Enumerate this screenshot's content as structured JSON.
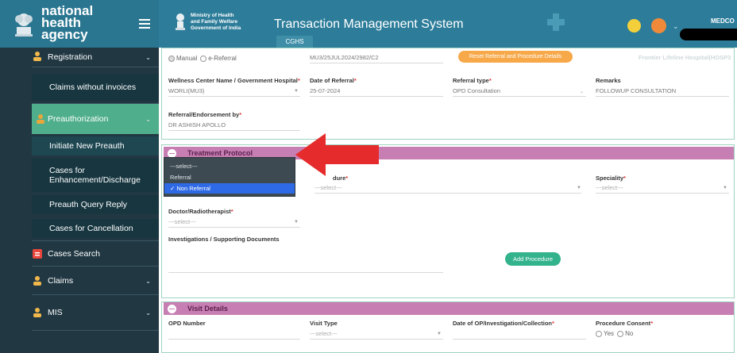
{
  "header": {
    "brand_line1": "national",
    "brand_line2": "health",
    "brand_line3": "agency",
    "ministry_line1": "Ministry of Health",
    "ministry_line2": "and Family Welfare",
    "ministry_line3": "Government of India",
    "title": "Transaction Management System",
    "tab_label": "CGHS",
    "user_label": "MEDCO"
  },
  "sidebar": {
    "registration": "Registration",
    "claims_without_invoices": "Claims without invoices",
    "preauthorization": "Preauthorization",
    "initiate_new_preauth": "Initiate New Preauth",
    "cases_enhancement_line1": "Cases for",
    "cases_enhancement_line2": "Enhancement/Discharge",
    "preauth_query_reply": "Preauth Query Reply",
    "cases_cancellation": "Cases for Cancellation",
    "cases_search": "Cases Search",
    "claims": "Claims",
    "mis": "MIS"
  },
  "referral": {
    "type_manual": "Manual",
    "type_ereferral": "e-Referral",
    "referral_number": "MU3/25JUL2024/2982/C2",
    "reset_button": "Reset Referral and Procedure Details",
    "hospital_faint": "Frontier Lifeline Hospital(HOSP3",
    "wellness_label": "Wellness Center Name / Government Hospital",
    "wellness_value": "WORLI(MU3)",
    "date_label": "Date of Referral",
    "date_value": "25-07-2024",
    "type_label": "Referral type",
    "type_value": "OPD Consultation",
    "remarks_label": "Remarks",
    "remarks_value": "FOLLOWUP CONSULTATION",
    "endorsement_label": "Referral/Endorsement by",
    "endorsement_value": "DR ASHISH APOLLO"
  },
  "treatment": {
    "section_title": "Treatment Protocol",
    "dropdown_options": [
      "---select---",
      "Referral",
      "Non Referral"
    ],
    "dropdown_selected_mark": "✓",
    "procedure_label": "dure",
    "procedure_value": "---select---",
    "speciality_label": "Speciality",
    "speciality_value": "---select---",
    "doctor_label": "Doctor/Radiotherapist",
    "doctor_value": "---select---",
    "investigations_label": "Investigations / Supporting Documents",
    "add_procedure": "Add Procedure"
  },
  "visit": {
    "section_title": "Visit Details",
    "opd_label": "OPD Number",
    "visit_type_label": "Visit Type",
    "visit_type_value": "---select---",
    "date_label": "Date of OP/Investigation/Collection",
    "consent_label": "Procedure Consent",
    "consent_yes": "Yes",
    "consent_no": "No"
  },
  "required_mark": "*"
}
